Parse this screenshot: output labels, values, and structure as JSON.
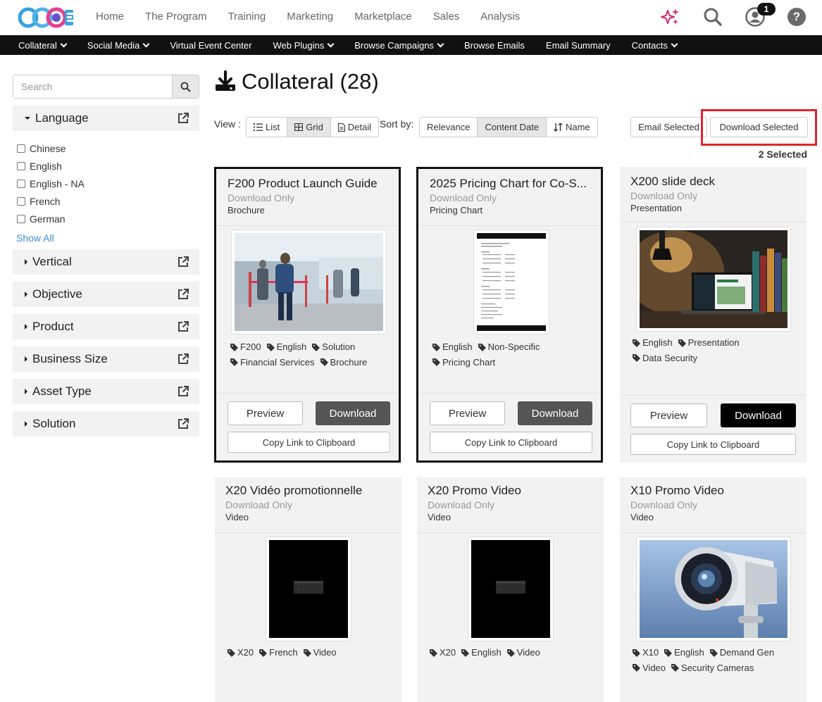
{
  "topnav": [
    "Home",
    "The Program",
    "Training",
    "Marketing",
    "Marketplace",
    "Sales",
    "Analysis"
  ],
  "logo_text": "CCOE",
  "notification_count": "1",
  "help_label": "?",
  "subnav": [
    {
      "label": "Collateral",
      "dropdown": true
    },
    {
      "label": "Social Media",
      "dropdown": true
    },
    {
      "label": "Virtual Event Center",
      "dropdown": false
    },
    {
      "label": "Web Plugins",
      "dropdown": true
    },
    {
      "label": "Browse Campaigns",
      "dropdown": true
    },
    {
      "label": "Browse Emails",
      "dropdown": false
    },
    {
      "label": "Email Summary",
      "dropdown": false
    },
    {
      "label": "Contacts",
      "dropdown": true
    }
  ],
  "sidebar": {
    "search_placeholder": "Search",
    "language_label": "Language",
    "languages": [
      "Chinese",
      "English",
      "English - NA",
      "French",
      "German"
    ],
    "show_all": "Show All",
    "facets": [
      "Vertical",
      "Objective",
      "Product",
      "Business Size",
      "Asset Type",
      "Solution"
    ]
  },
  "main": {
    "title": "Collateral (28)",
    "view_label": "View :",
    "view_options": [
      "List",
      "Grid",
      "Detail"
    ],
    "active_view": "Grid",
    "sort_label": "Sort by:",
    "sort_options": [
      "Relevance",
      "Content Date",
      "Name"
    ],
    "active_sort": "Content Date",
    "email_selected": "Email Selected",
    "download_selected": "Download Selected",
    "selected_count": "2 Selected"
  },
  "cards": [
    {
      "title": "F200 Product Launch Guide",
      "meta": "Download Only",
      "type": "Brochure",
      "tags": [
        "F200",
        "English",
        "Solution",
        "Financial Services",
        "Brochure"
      ],
      "selected": true
    },
    {
      "title": "2025 Pricing Chart for Co-S...",
      "meta": "Download Only",
      "type": "Pricing Chart",
      "tags": [
        "English",
        "Non-Specific",
        "Pricing Chart"
      ],
      "selected": true
    },
    {
      "title": "X200 slide deck",
      "meta": "Download Only",
      "type": "Presentation",
      "tags": [
        "English",
        "Presentation",
        "Data Security"
      ],
      "selected": false
    },
    {
      "title": "X20 Vidéo promotionnelle",
      "meta": "Download Only",
      "type": "Video",
      "tags": [
        "X20",
        "French",
        "Video"
      ],
      "selected": false
    },
    {
      "title": "X20 Promo Video",
      "meta": "Download Only",
      "type": "Video",
      "tags": [
        "X20",
        "English",
        "Video"
      ],
      "selected": false
    },
    {
      "title": "X10 Promo Video",
      "meta": "Download Only",
      "type": "Video",
      "tags": [
        "X10",
        "English",
        "Demand Gen",
        "Video",
        "Security Cameras"
      ],
      "selected": false
    }
  ],
  "card_buttons": {
    "preview": "Preview",
    "download": "Download",
    "copy": "Copy Link to Clipboard"
  },
  "colors": {
    "selected_border": "#111111",
    "highlight_red": "#e0242d",
    "download_selected_bg": "#555555",
    "download_bg": "#000000",
    "link_blue": "#3b8fd6"
  }
}
